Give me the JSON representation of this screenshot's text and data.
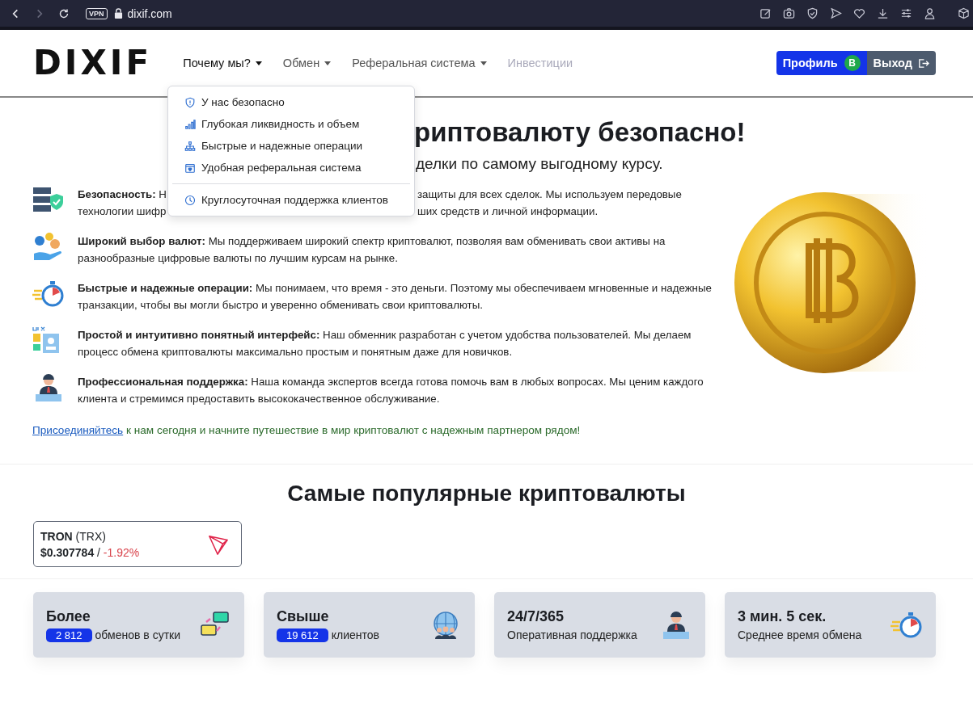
{
  "browser": {
    "vpn_badge": "VPN",
    "url": "dixif.com",
    "forward_disabled": true
  },
  "header": {
    "logo": "DIXIF",
    "nav": [
      {
        "label": "Почему мы?",
        "kind": "dropdown",
        "expanded": true,
        "disabled": false
      },
      {
        "label": "Обмен",
        "kind": "dropdown",
        "expanded": false,
        "disabled": false
      },
      {
        "label": "Реферальная система",
        "kind": "dropdown",
        "expanded": false,
        "disabled": false
      },
      {
        "label": "Инвестиции",
        "kind": "link",
        "expanded": false,
        "disabled": true
      }
    ],
    "profile_button": "Профиль",
    "profile_badge": "B",
    "logout_button": "Выход"
  },
  "dropdown": {
    "items": [
      {
        "label": "У нас безопасно",
        "divider_before": false
      },
      {
        "label": "Глубокая ликвидность и объем",
        "divider_before": false
      },
      {
        "label": "Быстрые и надежные операции",
        "divider_before": false
      },
      {
        "label": "Удобная реферальная система",
        "divider_before": false
      },
      {
        "label": "Круглосуточная поддержка клиентов",
        "divider_before": true
      }
    ]
  },
  "hero": {
    "title": "риптовалюту безопасно!",
    "subtitle": "делки по самому выгодному курсу."
  },
  "features": [
    {
      "kind": "covered",
      "lines": [
        [
          "**Безопасность:** Н",
          "защиты для всех сделок. Мы используем передовые"
        ],
        [
          "технологии шифр",
          "ших средств и личной информации."
        ]
      ]
    },
    {
      "kind": "full",
      "title": "Широкий выбор валют:",
      "text": "Мы поддерживаем широкий спектр криптовалют, позволяя вам обменивать свои активы на разнообразные цифровые валюты по лучшим курсам на рынке."
    },
    {
      "kind": "full",
      "title": "Быстрые и надежные операции:",
      "text": "Мы понимаем, что время - это деньги. Поэтому мы обеспечиваем мгновенные и надежные транзакции, чтобы вы могли быстро и уверенно обменивать свои криптовалюты."
    },
    {
      "kind": "full",
      "title": "Простой и интуитивно понятный интерфейс:",
      "text": "Наш обменник разработан с учетом удобства пользователей. Мы делаем процесс обмена криптовалюты максимально простым и понятным даже для новичков."
    },
    {
      "kind": "full",
      "title": "Профессиональная поддержка:",
      "text": "Наша команда экспертов всегда готова помочь вам в любых вопросах. Мы ценим каждого клиента и стремимся предоставить высококачественное обслуживание."
    }
  ],
  "cta": {
    "link": "Присоединяйтесь",
    "text": "к нам сегодня и начните путешествие в мир криптовалют с надежным партнером рядом!"
  },
  "popular": {
    "heading": "Самые популярные криптовалюты",
    "cards": [
      {
        "name": "TRON",
        "ticker": "(TRX)",
        "price": "$0.307784",
        "separator": "/",
        "change": "-1.92%"
      }
    ]
  },
  "stats": [
    {
      "title": "Более",
      "badge": "2 812",
      "text": "обменов в сутки"
    },
    {
      "title": "Свыше",
      "badge": "19 612",
      "text": "клиентов"
    },
    {
      "title": "24/7/365",
      "text": "Оперативная поддержка"
    },
    {
      "title": "3 мин. 5 сек.",
      "text": "Среднее время обмена"
    }
  ]
}
